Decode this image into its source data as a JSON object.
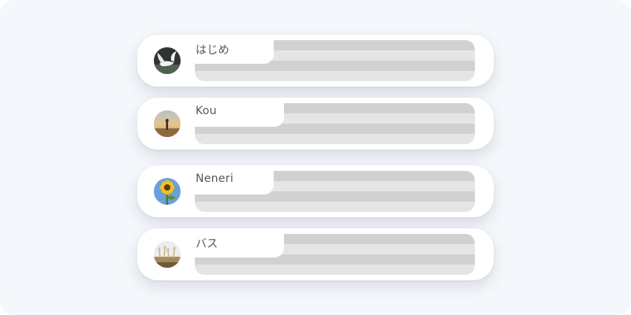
{
  "users": [
    {
      "name": "はじめ",
      "avatar": "dove-in-flight"
    },
    {
      "name": "Kou",
      "avatar": "person-at-sunset"
    },
    {
      "name": "Neneri",
      "avatar": "sunflower-blue-sky"
    },
    {
      "name": "バス",
      "avatar": "field-pampas-grass"
    }
  ]
}
